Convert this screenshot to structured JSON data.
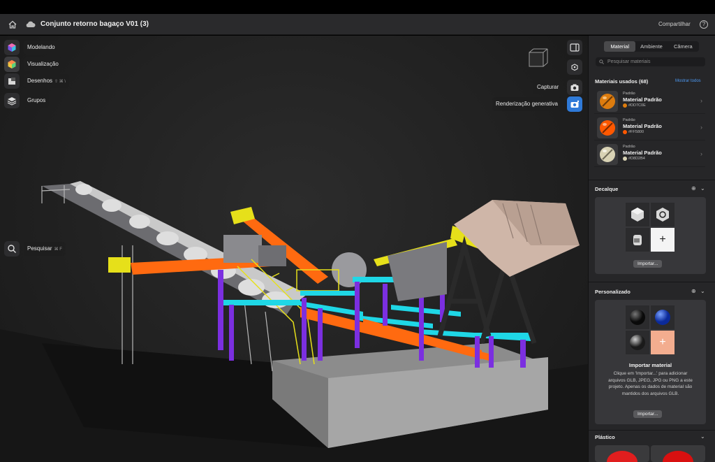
{
  "titlebar": {
    "title": "Conjunto retorno bagaço V01 (3)",
    "share_label": "Compartilhar",
    "help_label": "?"
  },
  "left_toolbar": {
    "items": [
      {
        "label": "Modelando",
        "icon": "cube-icon"
      },
      {
        "label": "Visualização",
        "icon": "colorful-cube-icon"
      },
      {
        "label": "Desenhos",
        "shortcut": "⇧ ⌘ \\",
        "icon": "drawings-icon"
      },
      {
        "label": "Grupos",
        "icon": "layers-icon"
      }
    ],
    "search": {
      "label": "Pesquisar",
      "shortcut": "⌘ F"
    }
  },
  "right_toolbar": {
    "capture_label": "Capturar",
    "generative_label": "Renderização generativa"
  },
  "panel": {
    "tabs": [
      "Material",
      "Ambiente",
      "Câmera"
    ],
    "active_tab": "Material",
    "search_placeholder": "Pesquisar materiais",
    "used_title": "Materiais usados (68)",
    "show_all": "Mostrar todos",
    "materials": [
      {
        "category": "Padrão",
        "name": "Material Padrão",
        "hex": "#DD7C0E",
        "color": "#DD7C0E"
      },
      {
        "category": "Padrão",
        "name": "Material Padrão",
        "hex": "#FF5800",
        "color": "#FF5800"
      },
      {
        "category": "Padrão",
        "name": "Material Padrão",
        "hex": "#D8D2B4",
        "color": "#D8D2B4"
      }
    ],
    "decal": {
      "title": "Decalque",
      "import_label": "Importar..."
    },
    "custom": {
      "title": "Personalizado",
      "import_title": "Importar material",
      "import_text": "Clique em 'Importar...' para adicionar arquivos GLB, JPEG, JPG ou PNG a este projeto. Apenas os dados de material são mantidos dos arquivos GLB.",
      "import_label": "Importar..."
    },
    "plastic": {
      "title": "Plástico"
    }
  },
  "colors": {
    "accent": "#2f7ad8",
    "link": "#4d9af4",
    "orange": "#ff6a10",
    "yellow": "#e6e01a",
    "cyan": "#1fd7e6",
    "purple": "#7b2fe0"
  }
}
